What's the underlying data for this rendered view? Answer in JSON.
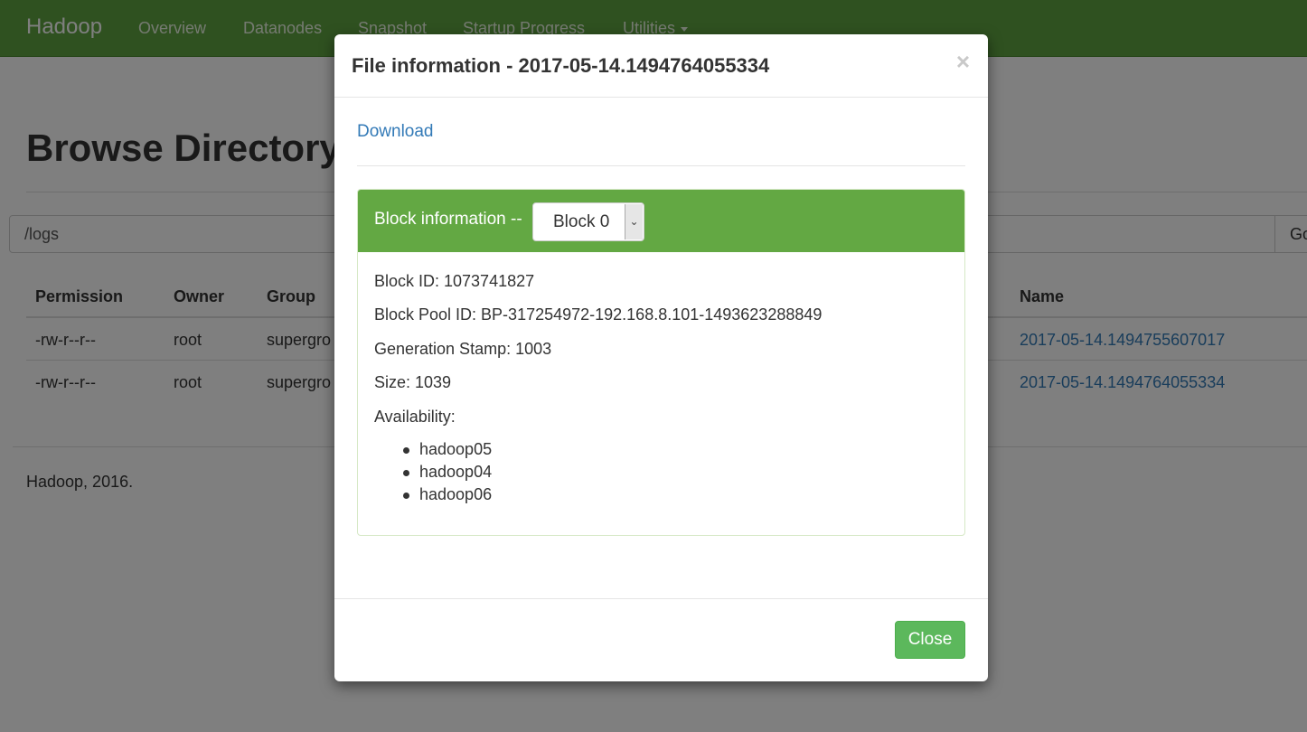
{
  "navbar": {
    "brand": "Hadoop",
    "items": [
      "Overview",
      "Datanodes",
      "Snapshot",
      "Startup Progress",
      "Utilities"
    ]
  },
  "page": {
    "title": "Browse Directory",
    "path_value": "/logs",
    "go_label": "Go",
    "footer": "Hadoop, 2016."
  },
  "table": {
    "headers": [
      "Permission",
      "Owner",
      "Group",
      "Name"
    ],
    "rows": [
      {
        "permission": "-rw-r--r--",
        "owner": "root",
        "group": "supergro",
        "name": "2017-05-14.1494755607017"
      },
      {
        "permission": "-rw-r--r--",
        "owner": "root",
        "group": "supergro",
        "name": "2017-05-14.1494764055334"
      }
    ]
  },
  "modal": {
    "title": "File information - 2017-05-14.1494764055334",
    "close_symbol": "×",
    "download_label": "Download",
    "block_heading": "Block information --",
    "block_selected": "Block 0",
    "block_id": "Block ID: 1073741827",
    "block_pool_id": "Block Pool ID: BP-317254972-192.168.8.101-1493623288849",
    "generation_stamp": "Generation Stamp: 1003",
    "size": "Size: 1039",
    "availability_label": "Availability:",
    "availability": [
      "hadoop05",
      "hadoop04",
      "hadoop06"
    ],
    "close_button": "Close"
  },
  "colors": {
    "navbar": "#5fa341",
    "panel_heading": "#63a843",
    "link": "#337ab7",
    "close_button": "#5cb85c"
  }
}
